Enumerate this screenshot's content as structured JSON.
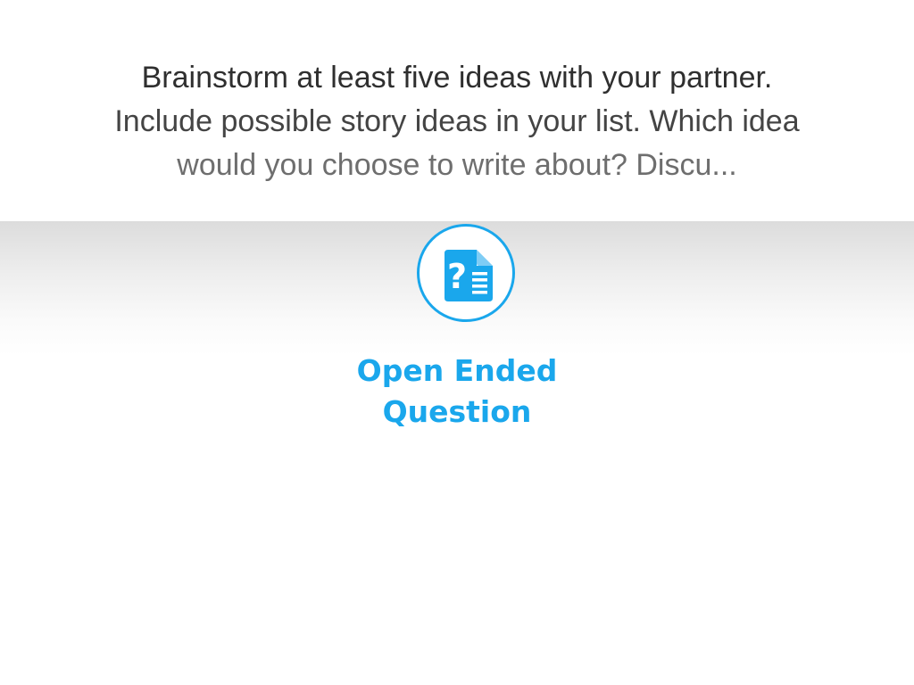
{
  "question": {
    "prompt_lines": [
      "Brainstorm at least five ideas with your partner.",
      "Include possible story ideas in your list. Which idea",
      "would you choose to write about? Discu..."
    ]
  },
  "question_type": {
    "icon": "open-ended-question-icon",
    "label_lines": [
      "Open Ended",
      "Question"
    ]
  },
  "colors": {
    "accent": "#1aa7ec",
    "prompt_text": "#2f2f2f"
  }
}
